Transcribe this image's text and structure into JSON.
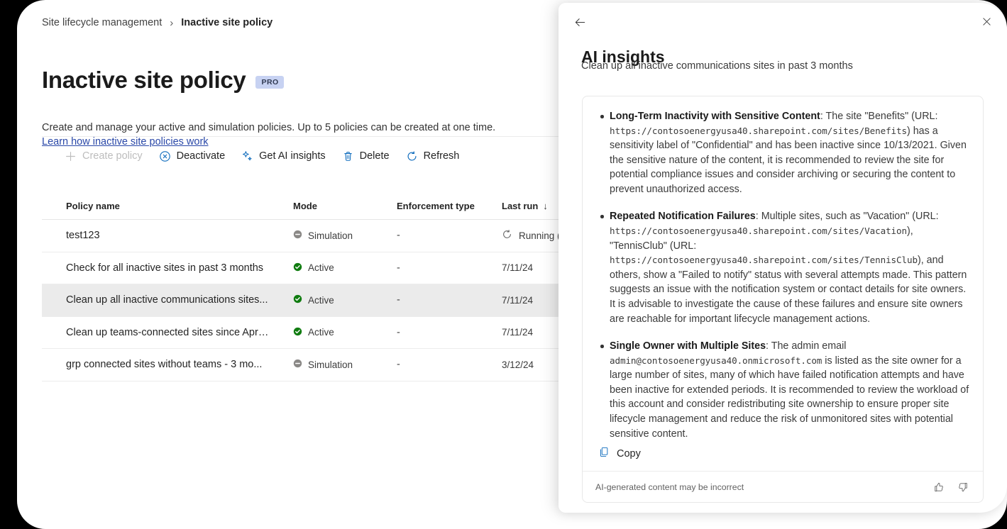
{
  "breadcrumb": {
    "parent": "Site lifecycle management",
    "separator": "›",
    "current": "Inactive site policy"
  },
  "page": {
    "title": "Inactive site policy",
    "badge": "PRO",
    "description": "Create and manage your active and simulation policies. Up to 5 policies can be created at one time.",
    "link": "Learn how inactive site policies work"
  },
  "toolbar": {
    "create": "Create policy",
    "deactivate": "Deactivate",
    "get_ai_insights": "Get AI insights",
    "delete": "Delete",
    "refresh": "Refresh"
  },
  "table": {
    "columns": [
      "Policy name",
      "Mode",
      "Enforcement type",
      "Last run"
    ],
    "sort_column": "Last run",
    "sort_indicator": "↓",
    "rows": [
      {
        "name": "test123",
        "mode": "Simulation",
        "mode_state": "simulation",
        "enforcement": "-",
        "last_run": "Running (this m",
        "last_run_state": "running"
      },
      {
        "name": "Check for all inactive sites in past 3 months",
        "mode": "Active",
        "mode_state": "active",
        "enforcement": "-",
        "last_run": "7/11/24",
        "last_run_state": "date"
      },
      {
        "name": "Clean up all inactive communications sites...",
        "mode": "Active",
        "mode_state": "active",
        "enforcement": "-",
        "last_run": "7/11/24",
        "last_run_state": "date",
        "selected": true
      },
      {
        "name": "Clean up teams-connected sites since Apri...",
        "mode": "Active",
        "mode_state": "active",
        "enforcement": "-",
        "last_run": "7/11/24",
        "last_run_state": "date"
      },
      {
        "name": "grp connected sites without teams - 3 mo...",
        "mode": "Simulation",
        "mode_state": "simulation",
        "enforcement": "-",
        "last_run": "3/12/24",
        "last_run_state": "date"
      }
    ]
  },
  "ai_panel": {
    "title": "AI insights",
    "subtitle": "Clean up all inactive communications sites in past 3 months",
    "back_icon": "back-arrow-icon",
    "close_icon": "close-icon",
    "insights": [
      {
        "heading": "Long-Term Inactivity with Sensitive Content",
        "body_1": ": The site \"Benefits\" (URL: ",
        "url": "https://contosoenergyusa40.sharepoint.com/sites/Benefits",
        "body_2": ") has a sensitivity label of \"Confidential\" and has been inactive since 10/13/2021. Given the sensitive nature of the content, it is recommended to review the site for potential compliance issues and consider archiving or securing the content to prevent unauthorized access."
      },
      {
        "heading": "Repeated Notification Failures",
        "body_1": ": Multiple sites, such as \"Vacation\" (URL: ",
        "url": "https://contosoenergyusa40.sharepoint.com/sites/Vacation",
        "body_2": "), \"TennisClub\" (URL: ",
        "url_2": "https://contosoenergyusa40.sharepoint.com/sites/TennisClub",
        "body_3": "), and others, show a \"Failed to notify\" status with several attempts made. This pattern suggests an issue with the notification system or contact details for site owners. It is advisable to investigate the cause of these failures and ensure site owners are reachable for important lifecycle management actions."
      },
      {
        "heading": "Single Owner with Multiple Sites",
        "body_1": ": The admin email ",
        "url": "admin@contosoenergyusa40.onmicrosoft.com",
        "body_2": " is listed as the site owner for a large number of sites, many of which have failed notification attempts and have been inactive for extended periods. It is recommended to review the workload of this account and consider redistributing site ownership to ensure proper site lifecycle management and reduce the risk of unmonitored sites with potential sensitive content."
      }
    ],
    "copy_label": "Copy",
    "disclaimer": "AI-generated content may be incorrect",
    "thumbs_up_icon": "thumbs-up-icon",
    "thumbs_down_icon": "thumbs-down-icon"
  },
  "colors": {
    "accent": "#0f6cbd",
    "active_status": "#107c10",
    "simulation_status": "#8a8886",
    "badge_bg": "#c7d2f2",
    "link": "#2a48a8",
    "selected_row": "#ebebeb"
  }
}
